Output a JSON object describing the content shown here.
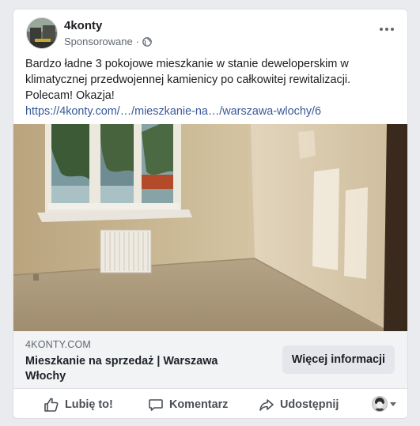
{
  "post": {
    "page_name": "4konty",
    "sponsored_label": "Sponsorowane",
    "separator": "·",
    "privacy_icon": "globe-icon",
    "more_icon": "more-options-icon",
    "body_text": "Bardzo ładne 3 pokojowe mieszkanie w stanie deweloperskim w klimatycznej przedwojennej kamienicy po całkowitej rewitalizacji. Polecam! Okazja!",
    "link_text": "https://4konty.com/…/mieszkanie-na…/warszawa-wlochy/6"
  },
  "link_preview": {
    "domain": "4KONTY.COM",
    "headline": "Mieszkanie na sprzedaż | Warszawa Włochy",
    "cta_label": "Więcej informacji"
  },
  "actions": {
    "like_label": "Lubię to!",
    "comment_label": "Komentarz",
    "share_label": "Udostępnij"
  },
  "colors": {
    "link": "#385898",
    "action_text": "#4b4f56",
    "footer_bg": "#f2f3f5"
  }
}
